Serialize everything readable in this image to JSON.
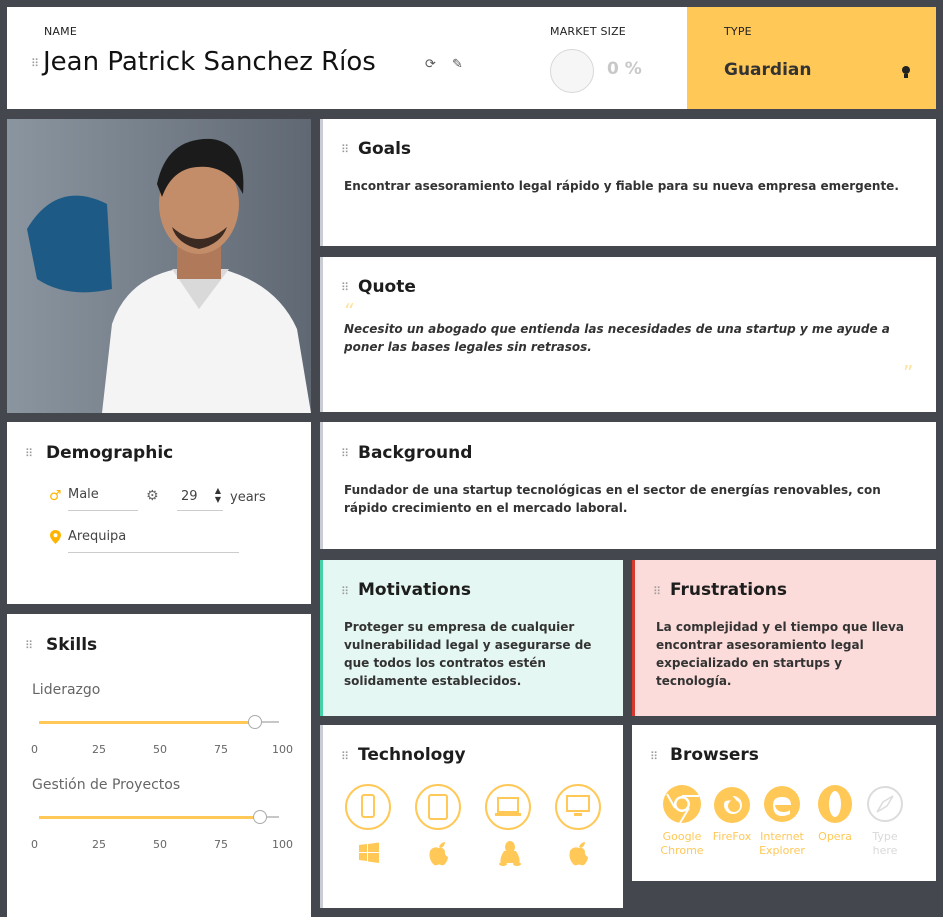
{
  "header": {
    "name_label": "NAME",
    "name": "Jean Patrick Sanchez Ríos",
    "market_label": "MARKET SIZE",
    "market_value": "0 %",
    "type_label": "TYPE",
    "type_value": "Guardian"
  },
  "goals": {
    "title": "Goals",
    "text": "Encontrar asesoramiento legal rápido y fiable para su nueva empresa emergente."
  },
  "quote": {
    "title": "Quote",
    "text": "Necesito un abogado que entienda las necesidades de una startup y me ayude a poner las bases legales sin retrasos."
  },
  "demographic": {
    "title": "Demographic",
    "gender": "Male",
    "age": "29",
    "age_unit": "years",
    "location": "Arequipa"
  },
  "background": {
    "title": "Background",
    "text": "Fundador de una startup tecnológicas en el sector de energías renovables, con rápido crecimiento en el mercado laboral."
  },
  "skills": {
    "title": "Skills",
    "ticks": [
      "0",
      "25",
      "50",
      "75",
      "100"
    ],
    "items": [
      {
        "label": "Liderazgo",
        "value": 90
      },
      {
        "label": "Gestión de Proyectos",
        "value": 92
      }
    ]
  },
  "motivations": {
    "title": "Motivations",
    "text": "Proteger su empresa de cualquier vulnerabilidad legal y asegurarse de que todos los contratos estén solidamente establecidos."
  },
  "frustrations": {
    "title": "Frustrations",
    "text": "La complejidad y el tiempo que lleva encontrar asesoramiento legal expecializado en startups y tecnología."
  },
  "technology": {
    "title": "Technology",
    "devices": [
      "mobile-icon",
      "tablet-icon",
      "laptop-icon",
      "desktop-icon"
    ],
    "platforms": [
      "windows-icon",
      "apple-icon",
      "linux-icon",
      "apple-icon"
    ]
  },
  "browsers": {
    "title": "Browsers",
    "items": [
      {
        "line1": "Google",
        "line2": "Chrome"
      },
      {
        "line1": "FireFox",
        "line2": ""
      },
      {
        "line1": "Internet",
        "line2": "Explorer"
      },
      {
        "line1": "Opera",
        "line2": ""
      },
      {
        "line1": "Type",
        "line2": "here"
      }
    ]
  },
  "colors": {
    "accent": "#ffc857",
    "motivations_bg": "#e5f7f2",
    "motivations_border": "#45d1a8",
    "frustrations_bg": "#fbdcda",
    "frustrations_border": "#d9382f",
    "background": "#44474d"
  }
}
